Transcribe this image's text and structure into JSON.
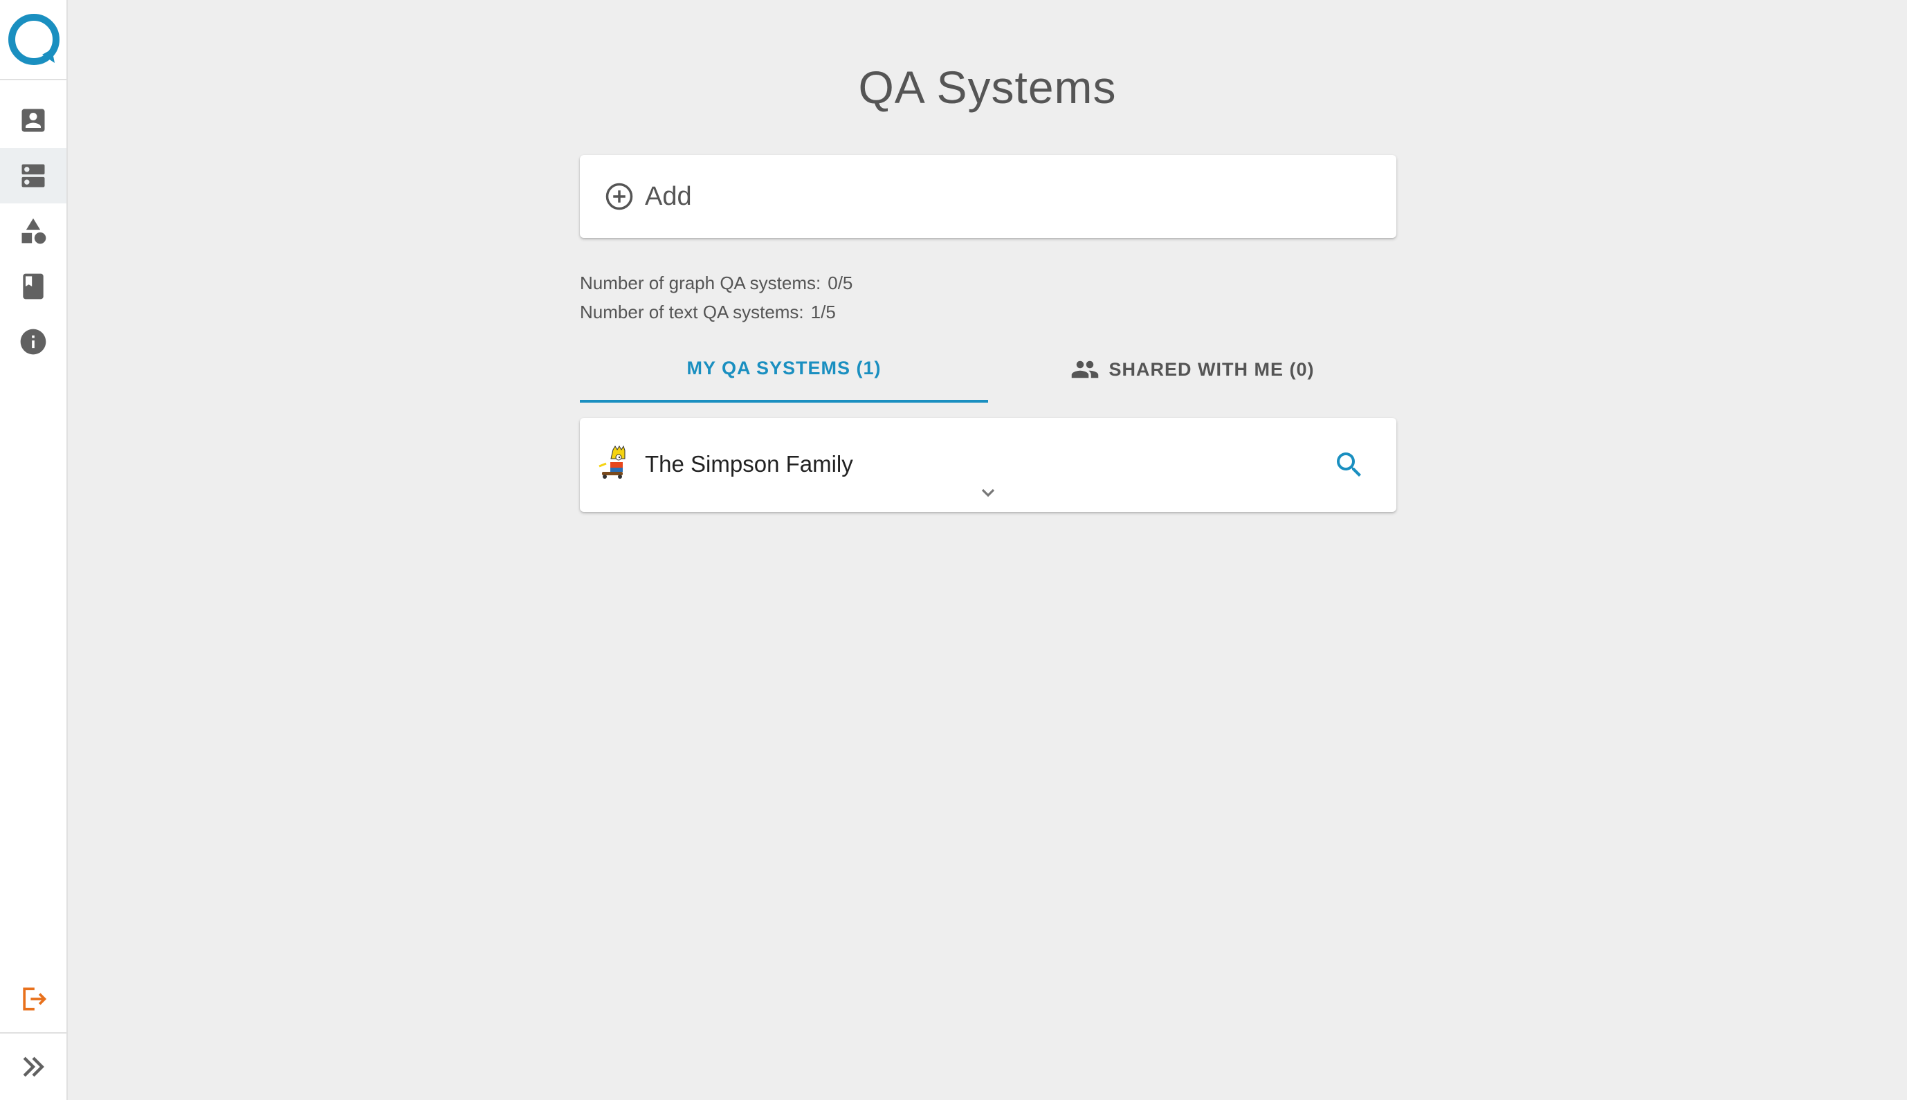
{
  "page": {
    "title": "QA Systems"
  },
  "sidebar": {
    "items": [
      {
        "icon": "account-box-icon",
        "name": "profile"
      },
      {
        "icon": "dns-icon",
        "name": "qa-systems",
        "active": true
      },
      {
        "icon": "category-icon",
        "name": "components"
      },
      {
        "icon": "book-icon",
        "name": "documentation"
      },
      {
        "icon": "info-icon",
        "name": "about"
      }
    ],
    "logout_icon": "logout-icon",
    "expand_icon": "double-chevron-right-icon"
  },
  "add_card": {
    "label": "Add",
    "icon": "add-circle-outline-icon"
  },
  "stats": {
    "graph_label": "Number of graph QA systems:",
    "graph_value": "0/5",
    "text_label": "Number of text QA systems:",
    "text_value": "1/5"
  },
  "tabs": {
    "my_label": "MY QA SYSTEMS (1)",
    "shared_label": "SHARED WITH ME (0)",
    "shared_icon": "people-icon"
  },
  "systems": [
    {
      "name": "The Simpson Family",
      "avatar": "bart-simpson-avatar"
    }
  ],
  "colors": {
    "accent": "#1a8fc0",
    "logout": "#e8711c",
    "background": "#eeeeee",
    "icon": "#616161"
  }
}
